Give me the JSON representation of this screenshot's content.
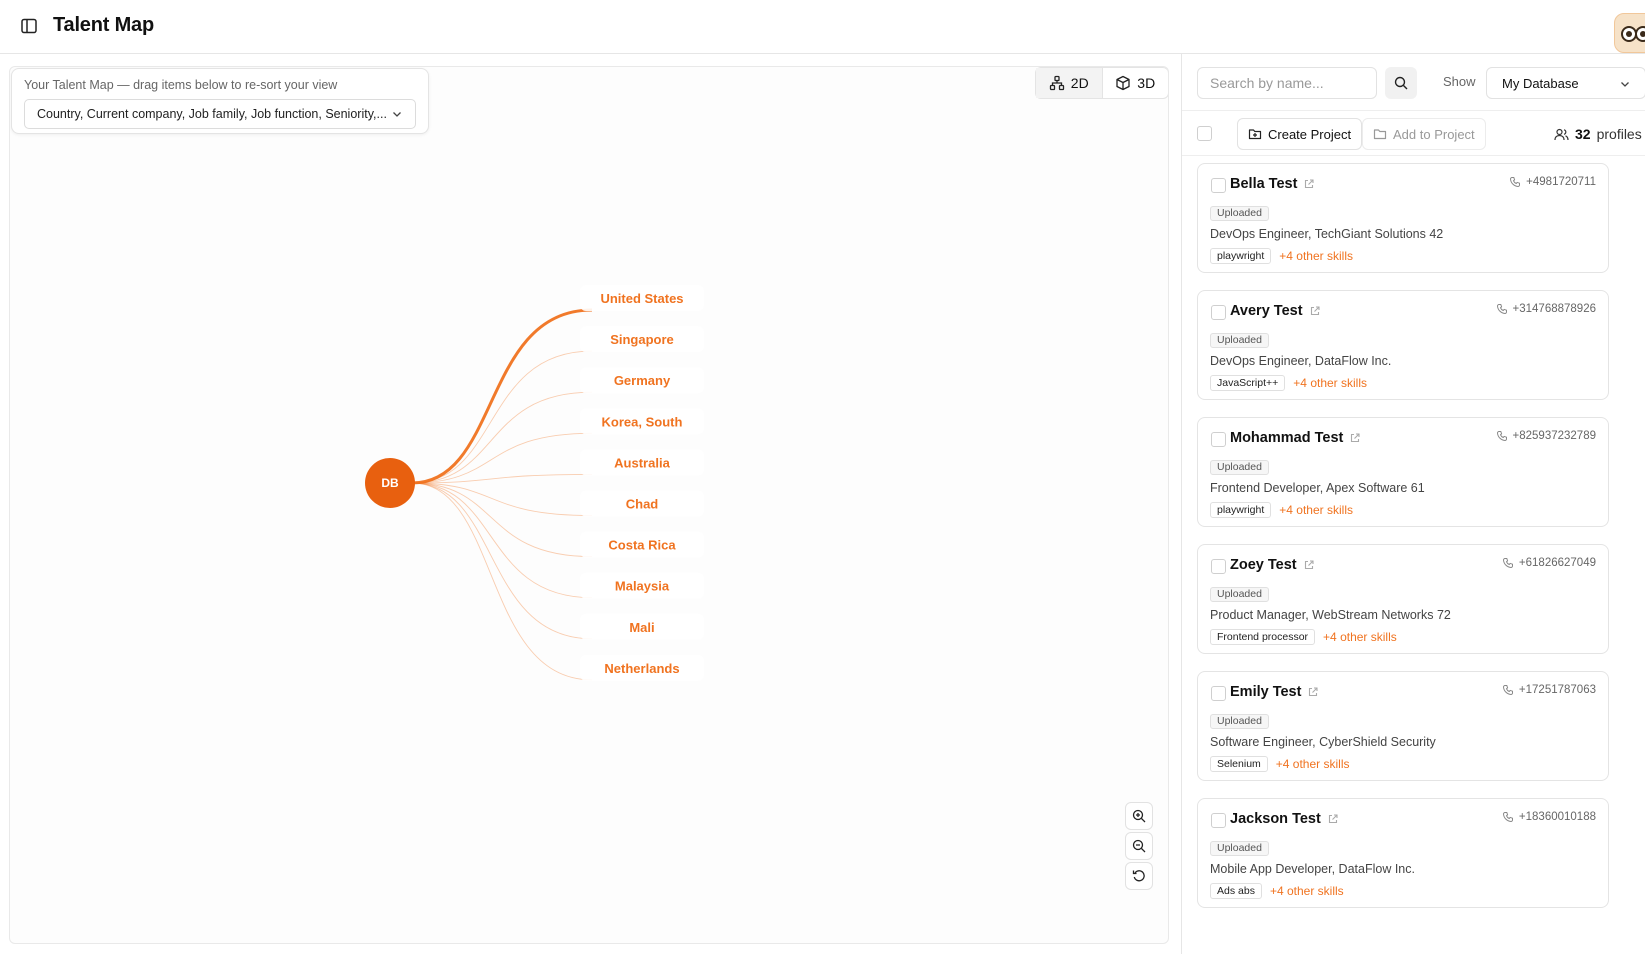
{
  "header": {
    "title": "Talent Map"
  },
  "colors": {
    "accent": "#f07320",
    "accent_dark": "#e8600f"
  },
  "sort": {
    "hint": "Your Talent Map — drag items below to re-sort your view",
    "value": "Country, Current company, Job family, Job function, Seniority,..."
  },
  "view_toggle": {
    "btn_2d": "2D",
    "btn_3d": "3D",
    "active": "2D"
  },
  "graph": {
    "root_label": "DB",
    "highlighted_index": 0,
    "nodes": [
      "United States",
      "Singapore",
      "Germany",
      "Korea, South",
      "Australia",
      "Chad",
      "Costa Rica",
      "Malaysia",
      "Mali",
      "Netherlands"
    ]
  },
  "right": {
    "search_placeholder": "Search by name...",
    "show_label": "Show",
    "show_value": "My Database",
    "create_project": "Create Project",
    "add_to_project": "Add to Project",
    "profile_count": "32",
    "profile_unit": "profiles"
  },
  "profiles": [
    {
      "name": "Bella Test",
      "phone": "+4981720711",
      "status": "Uploaded",
      "role": "DevOps Engineer, TechGiant Solutions 42",
      "skill": "playwright",
      "more": "+4 other skills"
    },
    {
      "name": "Avery Test",
      "phone": "+314768878926",
      "status": "Uploaded",
      "role": "DevOps Engineer, DataFlow Inc.",
      "skill": "JavaScript++",
      "more": "+4 other skills"
    },
    {
      "name": "Mohammad Test",
      "phone": "+825937232789",
      "status": "Uploaded",
      "role": "Frontend Developer, Apex Software 61",
      "skill": "playwright",
      "more": "+4 other skills"
    },
    {
      "name": "Zoey Test",
      "phone": "+61826627049",
      "status": "Uploaded",
      "role": "Product Manager, WebStream Networks 72",
      "skill": "Frontend processor",
      "more": "+4 other skills"
    },
    {
      "name": "Emily Test",
      "phone": "+17251787063",
      "status": "Uploaded",
      "role": "Software Engineer, CyberShield Security",
      "skill": "Selenium",
      "more": "+4 other skills"
    },
    {
      "name": "Jackson Test",
      "phone": "+18360010188",
      "status": "Uploaded",
      "role": "Mobile App Developer, DataFlow Inc.",
      "skill": "Ads abs",
      "more": "+4 other skills"
    }
  ]
}
